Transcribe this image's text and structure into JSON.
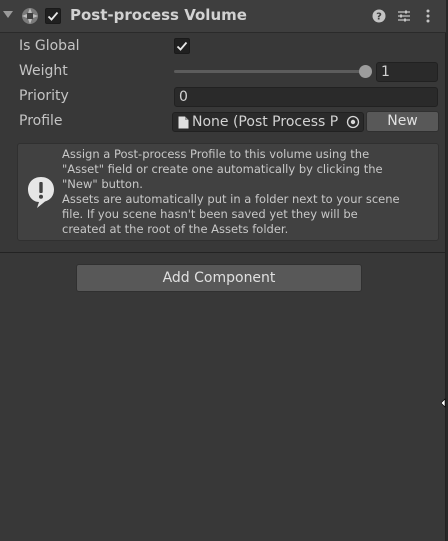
{
  "component": {
    "title": "Post-process Volume",
    "enabled": true
  },
  "fields": {
    "is_global_label": "Is Global",
    "is_global_value": true,
    "weight_label": "Weight",
    "weight_value": "1",
    "weight_slider_fraction": 1.0,
    "priority_label": "Priority",
    "priority_value": "0",
    "profile_label": "Profile",
    "profile_value": "None (Post Process P",
    "new_button": "New"
  },
  "help": {
    "lines": [
      "Assign a Post-process Profile to this volume using the",
      "\"Asset\" field or create one automatically by clicking the",
      "\"New\" button.",
      "Assets are automatically put in a folder next to your scene",
      "file. If you scene hasn't been saved yet they will be",
      "created at the root of the Assets folder."
    ]
  },
  "add_component_label": "Add Component",
  "icons": {
    "foldout": "foldout-arrow-icon",
    "component": "post-process-volume-icon",
    "help": "help-icon",
    "presets": "presets-icon",
    "menu": "kebab-menu-icon",
    "document": "document-icon",
    "picker": "object-picker-icon",
    "warning": "info-bubble-icon"
  },
  "colors": {
    "panel_bg": "#383838",
    "field_bg": "#2a2a2a",
    "button_bg": "#585858",
    "text": "#c4c4c4"
  }
}
